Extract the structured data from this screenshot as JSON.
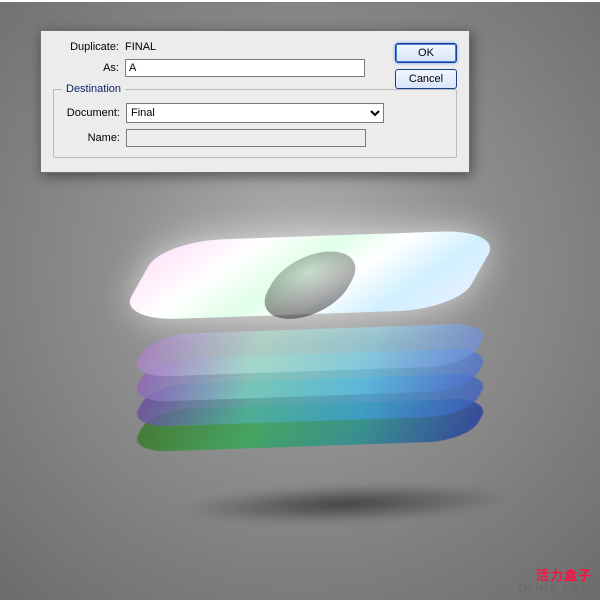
{
  "dialog": {
    "duplicate_label": "Duplicate:",
    "duplicate_value": "FINAL",
    "as_label": "As:",
    "as_value": "A",
    "group_title": "Destination",
    "document_label": "Document:",
    "document_value": "Final",
    "document_options": [
      "Final"
    ],
    "name_label": "Name:",
    "name_value": ""
  },
  "buttons": {
    "ok": "OK",
    "cancel": "Cancel"
  },
  "watermark": {
    "line1": "活力盒子",
    "line2": "OLiHE.COM"
  }
}
